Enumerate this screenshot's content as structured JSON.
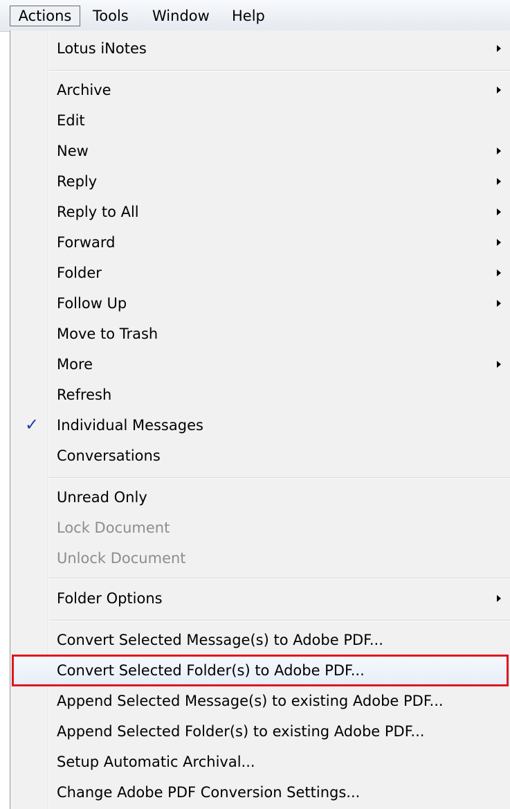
{
  "menubar": {
    "items": [
      "Actions",
      "Tools",
      "Window",
      "Help"
    ]
  },
  "menu": {
    "items": [
      {
        "label": "Lotus iNotes",
        "submenu": true
      },
      {
        "label": "Archive",
        "submenu": true
      },
      {
        "label": "Edit",
        "submenu": false
      },
      {
        "label": "New",
        "submenu": true
      },
      {
        "label": "Reply",
        "submenu": true
      },
      {
        "label": "Reply to All",
        "submenu": true
      },
      {
        "label": "Forward",
        "submenu": true
      },
      {
        "label": "Folder",
        "submenu": true
      },
      {
        "label": "Follow Up",
        "submenu": true
      },
      {
        "label": "Move to Trash",
        "submenu": false
      },
      {
        "label": "More",
        "submenu": true
      },
      {
        "label": "Refresh",
        "submenu": false
      },
      {
        "label": "Individual Messages",
        "checked": true
      },
      {
        "label": "Conversations",
        "submenu": false
      },
      {
        "label": "Unread Only",
        "submenu": false
      },
      {
        "label": "Lock Document",
        "disabled": true
      },
      {
        "label": "Unlock Document",
        "disabled": true
      },
      {
        "label": "Folder Options",
        "submenu": true
      },
      {
        "label": "Convert Selected Message(s) to Adobe PDF...",
        "submenu": false
      },
      {
        "label": "Convert Selected Folder(s) to Adobe PDF...",
        "highlighted": true
      },
      {
        "label": "Append Selected Message(s) to existing Adobe PDF...",
        "submenu": false
      },
      {
        "label": "Append Selected Folder(s) to existing Adobe PDF...",
        "submenu": false
      },
      {
        "label": "Setup Automatic Archival...",
        "submenu": false
      },
      {
        "label": "Change Adobe PDF Conversion Settings...",
        "submenu": false
      }
    ]
  },
  "colors": {
    "highlight_outline": "#e0161e",
    "check_mark": "#1a3fa6",
    "disabled_text": "#8d8d8d"
  }
}
